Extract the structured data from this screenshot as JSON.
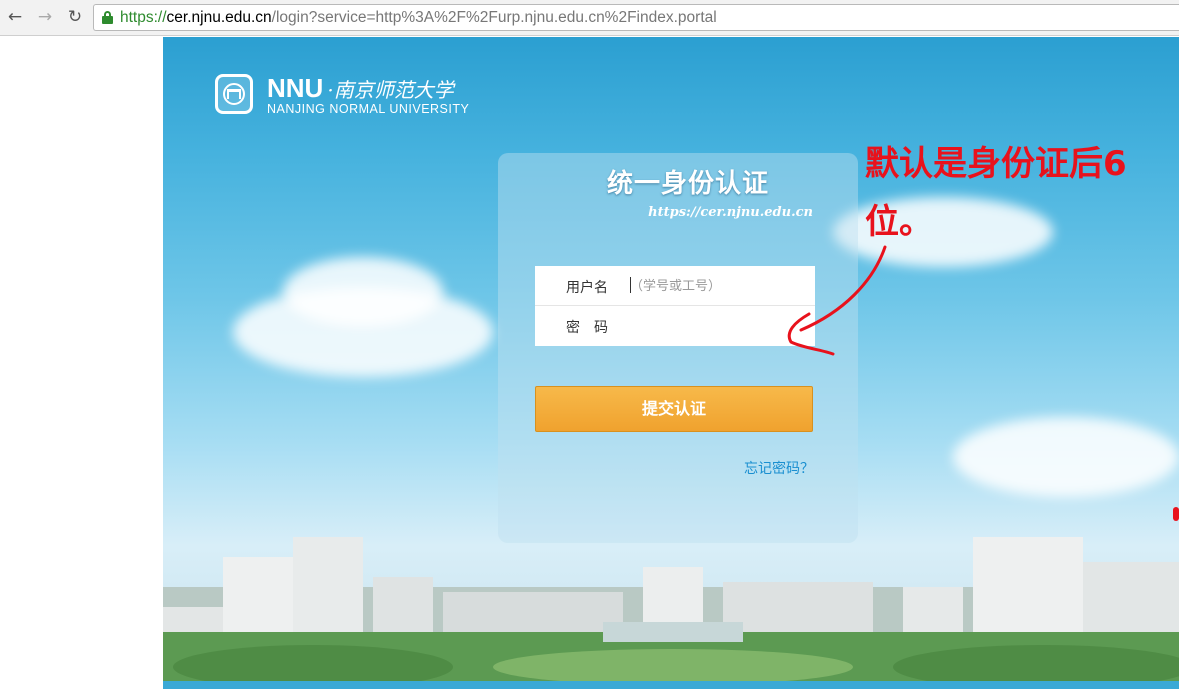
{
  "browser": {
    "url_scheme": "https://",
    "url_host": "cer.njnu.edu.cn",
    "url_path": "/login?service=http%3A%2F%2Furp.njnu.edu.cn%2Findex.portal",
    "back_icon": "arrow-left",
    "forward_icon": "arrow-right",
    "reload_icon": "reload"
  },
  "logo": {
    "abbr": "NNU",
    "chinese_name": "·南京师范大学",
    "english_name": "NANJING NORMAL UNIVERSITY",
    "seal_text": "NNU"
  },
  "login": {
    "title": "统一身份认证",
    "site_url": "https://cer.njnu.edu.cn",
    "username_label": "用户名",
    "username_placeholder": "（学号或工号）",
    "password_label": "密　码",
    "submit_label": "提交认证",
    "forgot_link": "忘记密码？"
  },
  "annotation": {
    "text": "默认是身份证后6位。",
    "color": "#e8121c"
  },
  "colors": {
    "submit_button": "#f0a22e",
    "link": "#1a8fd0",
    "sky": "#46b2de"
  }
}
